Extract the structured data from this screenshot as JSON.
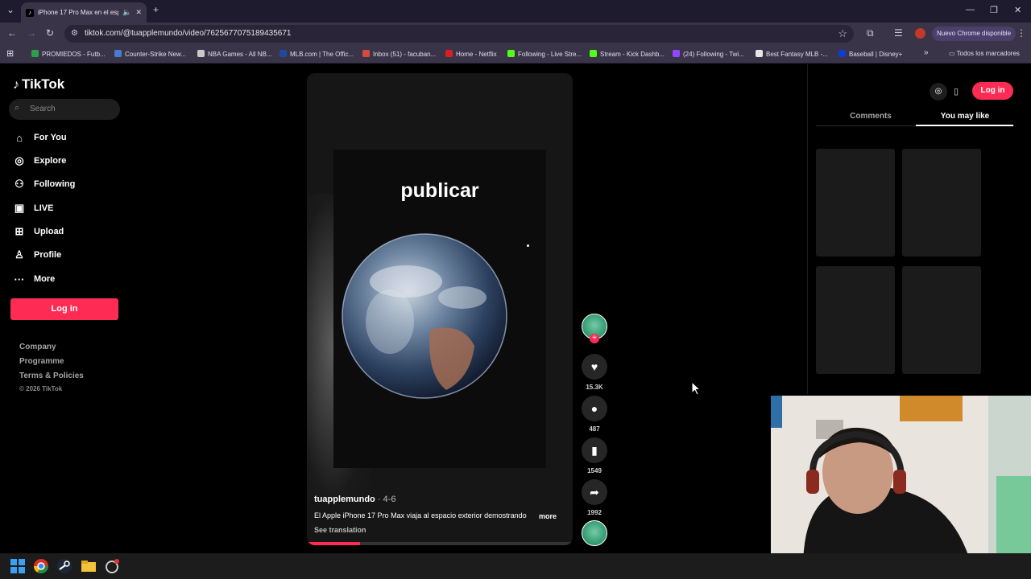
{
  "browser": {
    "tab_title": "iPhone 17 Pro Max en el esp",
    "url": "tiktok.com/@tuapplemundo/video/7625677075189435671",
    "update_label": "Nuevo Chrome disponible",
    "bookmarks": [
      {
        "label": "PROMIEDOS - Futb...",
        "color": "#2e9e4b"
      },
      {
        "label": "Counter-Strike New...",
        "color": "#4a7bd0"
      },
      {
        "label": "NBA Games - All NB...",
        "color": "#c9c9c9"
      },
      {
        "label": "MLB.com | The Offic...",
        "color": "#1d4a9e"
      },
      {
        "label": "Inbox (51) - facuban...",
        "color": "#d24b3c"
      },
      {
        "label": "Home - Netflix",
        "color": "#d81f26"
      },
      {
        "label": "Following - Live Stre...",
        "color": "#53fc18"
      },
      {
        "label": "Stream - Kick Dashb...",
        "color": "#53fc18"
      },
      {
        "label": "(24) Following - Twi...",
        "color": "#9146ff"
      },
      {
        "label": "Best Fantasy MLB -...",
        "color": "#e6e6e6"
      },
      {
        "label": "Baseball | Disney+",
        "color": "#113ccf"
      }
    ],
    "all_bookmarks_label": "Todos los marcadores"
  },
  "sidebar": {
    "brand": "TikTok",
    "search_placeholder": "Search",
    "nav": [
      {
        "label": "For You",
        "icon": "home-icon"
      },
      {
        "label": "Explore",
        "icon": "compass-icon"
      },
      {
        "label": "Following",
        "icon": "following-icon"
      },
      {
        "label": "LIVE",
        "icon": "live-icon"
      },
      {
        "label": "Upload",
        "icon": "upload-icon"
      },
      {
        "label": "Profile",
        "icon": "profile-icon"
      },
      {
        "label": "More",
        "icon": "more-icon"
      }
    ],
    "login_label": "Log in",
    "footer": [
      "Company",
      "Programme",
      "Terms & Policies"
    ],
    "copyright": "© 2026 TikTok"
  },
  "video": {
    "overlay_text": "publicar",
    "author": "tuapplemundo",
    "date": " · 4-6",
    "caption": "El Apple iPhone 17 Pro Max viaja al espacio exterior demostrando",
    "more_label": "more",
    "see_translation": "See translation",
    "progress": 0.2
  },
  "actions": {
    "likes": "15.3K",
    "comments": "487",
    "saves": "1549",
    "shares": "1992"
  },
  "right_panel": {
    "login_label": "Log in",
    "tabs": [
      "Comments",
      "You may like"
    ],
    "active_tab": "You may like"
  },
  "colors": {
    "accent": "#fe2c55"
  }
}
